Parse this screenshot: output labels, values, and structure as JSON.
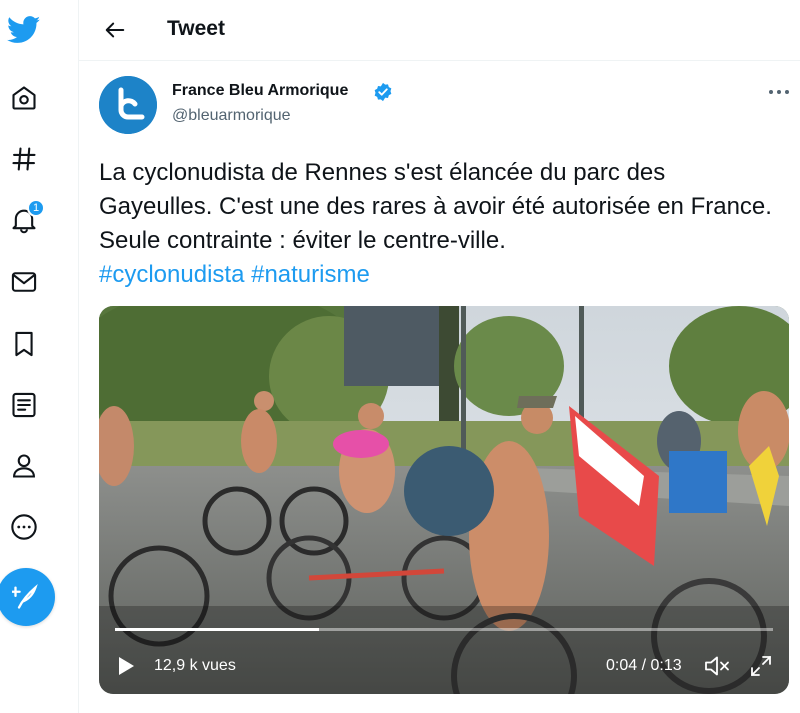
{
  "nav": {
    "notifications_count": "1",
    "items": [
      "twitter-logo",
      "home-icon",
      "explore-icon",
      "notifications-icon",
      "messages-icon",
      "bookmarks-icon",
      "lists-icon",
      "profile-icon",
      "more-icon",
      "compose-tweet-icon"
    ]
  },
  "header": {
    "title": "Tweet"
  },
  "tweet": {
    "author_name": "France Bleu Armorique",
    "author_handle": "@bleuarmorique",
    "text": "La cyclonudista de Rennes s'est élancée du parc des Gayeulles. C'est une des rares à avoir été autorisée en France. Seule contrainte : éviter le centre-ville.",
    "hashtags": [
      "#cyclonudista",
      "#naturisme"
    ]
  },
  "video": {
    "views": "12,9 k vues",
    "time": "0:04 / 0:13",
    "progress": 0.31
  },
  "colors": {
    "accent": "#1d9bf0",
    "text": "#0f1419",
    "secondary": "#536471"
  }
}
